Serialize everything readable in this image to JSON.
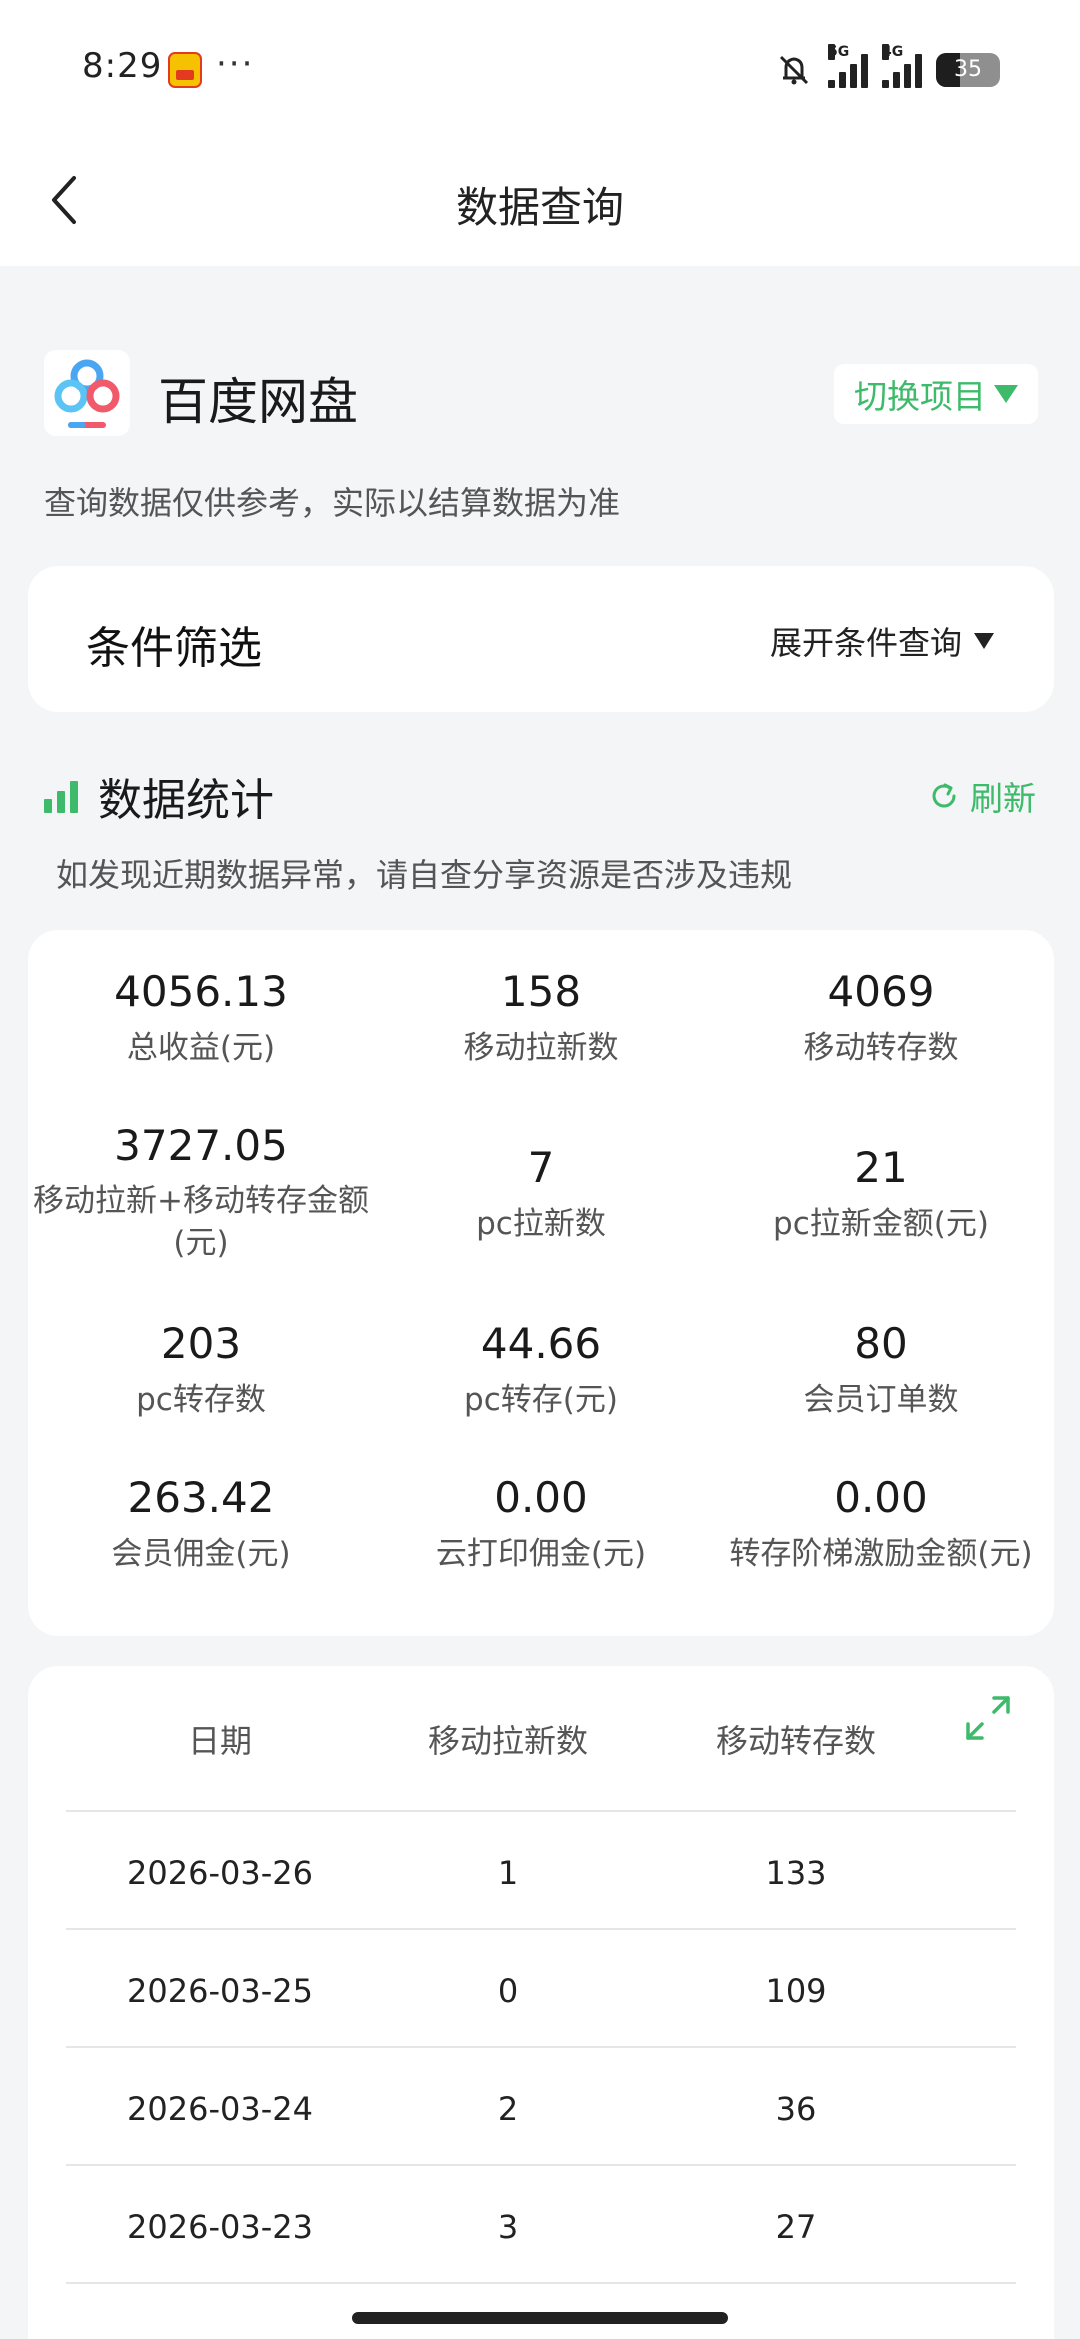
{
  "status_bar": {
    "time": "8:29",
    "more": "···",
    "signal1_tag": "5G",
    "signal2_tag": "4G",
    "battery": "35"
  },
  "nav": {
    "title": "数据查询"
  },
  "project": {
    "name": "百度网盘",
    "switch_label": "切换项目",
    "note": "查询数据仅供参考，实际以结算数据为准"
  },
  "filter": {
    "title": "条件筛选",
    "toggle_label": "展开条件查询"
  },
  "stats": {
    "title": "数据统计",
    "refresh_label": "刷新",
    "note": "如发现近期数据异常，请自查分享资源是否涉及违规",
    "items": [
      {
        "value": "4056.13",
        "label": "总收益(元)"
      },
      {
        "value": "158",
        "label": "移动拉新数"
      },
      {
        "value": "4069",
        "label": "移动转存数"
      },
      {
        "value": "3727.05",
        "label": "移动拉新+移动转存金额(元)"
      },
      {
        "value": "7",
        "label": "pc拉新数"
      },
      {
        "value": "21",
        "label": "pc拉新金额(元)"
      },
      {
        "value": "203",
        "label": "pc转存数"
      },
      {
        "value": "44.66",
        "label": "pc转存(元)"
      },
      {
        "value": "80",
        "label": "会员订单数"
      },
      {
        "value": "263.42",
        "label": "会员佣金(元)"
      },
      {
        "value": "0.00",
        "label": "云打印佣金(元)"
      },
      {
        "value": "0.00",
        "label": "转存阶梯激励金额(元)"
      }
    ]
  },
  "table": {
    "headers": [
      "日期",
      "移动拉新数",
      "移动转存数"
    ],
    "rows": [
      [
        "2026-03-26",
        "1",
        "133"
      ],
      [
        "2026-03-25",
        "0",
        "109"
      ],
      [
        "2026-03-24",
        "2",
        "36"
      ],
      [
        "2026-03-23",
        "3",
        "27"
      ]
    ]
  },
  "colors": {
    "accent": "#3dba6a",
    "background": "#f3f5f6",
    "card": "#ffffff"
  }
}
